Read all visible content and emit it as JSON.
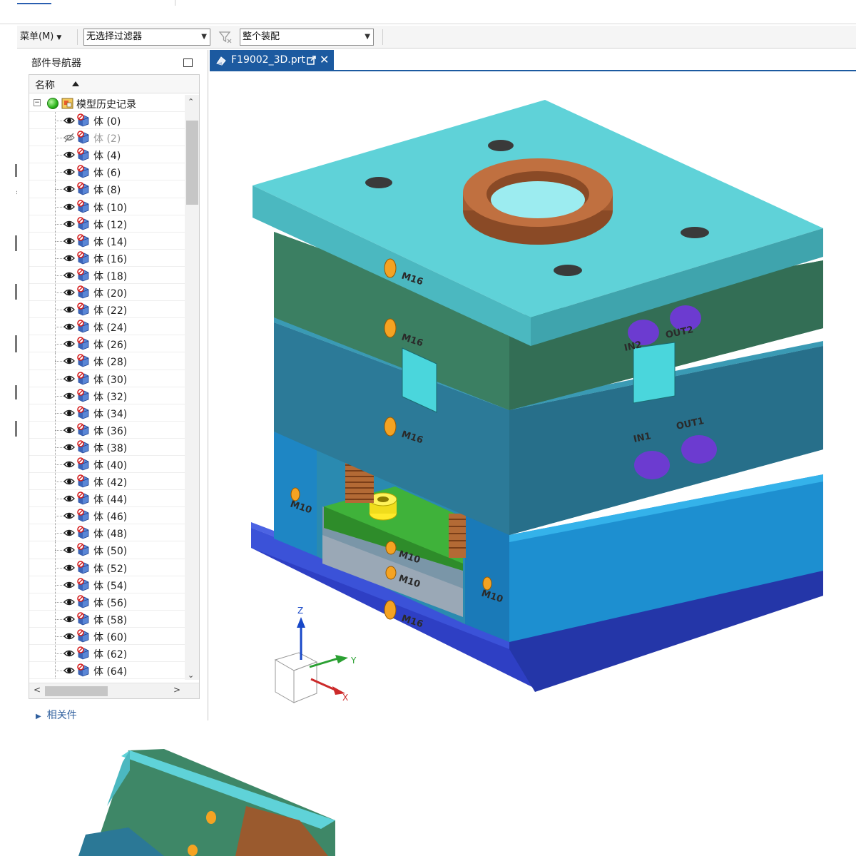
{
  "toolbar": {
    "menu_label": "菜单(M)",
    "filter_select": "无选择过滤器",
    "scope_select": "整个装配"
  },
  "navigator": {
    "title": "部件导航器",
    "column_name": "名称",
    "root_label": "模型历史记录",
    "items": [
      {
        "label": "体 (0)",
        "visible": true
      },
      {
        "label": "体 (2)",
        "visible": false
      },
      {
        "label": "体 (4)",
        "visible": true
      },
      {
        "label": "体 (6)",
        "visible": true
      },
      {
        "label": "体 (8)",
        "visible": true
      },
      {
        "label": "体 (10)",
        "visible": true
      },
      {
        "label": "体 (12)",
        "visible": true
      },
      {
        "label": "体 (14)",
        "visible": true
      },
      {
        "label": "体 (16)",
        "visible": true
      },
      {
        "label": "体 (18)",
        "visible": true
      },
      {
        "label": "体 (20)",
        "visible": true
      },
      {
        "label": "体 (22)",
        "visible": true
      },
      {
        "label": "体 (24)",
        "visible": true
      },
      {
        "label": "体 (26)",
        "visible": true
      },
      {
        "label": "体 (28)",
        "visible": true
      },
      {
        "label": "体 (30)",
        "visible": true
      },
      {
        "label": "体 (32)",
        "visible": true
      },
      {
        "label": "体 (34)",
        "visible": true
      },
      {
        "label": "体 (36)",
        "visible": true
      },
      {
        "label": "体 (38)",
        "visible": true
      },
      {
        "label": "体 (40)",
        "visible": true
      },
      {
        "label": "体 (42)",
        "visible": true
      },
      {
        "label": "体 (44)",
        "visible": true
      },
      {
        "label": "体 (46)",
        "visible": true
      },
      {
        "label": "体 (48)",
        "visible": true
      },
      {
        "label": "体 (50)",
        "visible": true
      },
      {
        "label": "体 (52)",
        "visible": true
      },
      {
        "label": "体 (54)",
        "visible": true
      },
      {
        "label": "体 (56)",
        "visible": true
      },
      {
        "label": "体 (58)",
        "visible": true
      },
      {
        "label": "体 (60)",
        "visible": true
      },
      {
        "label": "体 (62)",
        "visible": true
      },
      {
        "label": "体 (64)",
        "visible": true
      }
    ],
    "related_label": "相关件"
  },
  "tab": {
    "file_name": "F19002_3D.prt"
  },
  "model": {
    "labels": {
      "m16": "M16",
      "m10": "M10",
      "in1": "IN1",
      "in2": "IN2",
      "out1": "OUT1",
      "out2": "OUT2"
    },
    "axes": {
      "x": "X",
      "y": "Y",
      "z": "Z"
    },
    "colors": {
      "top_plate": "#5fd2d8",
      "a_plate": "#3f8a6a",
      "b_plate": "#2f7a8a",
      "support_block": "#1f96d4",
      "bottom_plate": "#3a4fd0",
      "locating_ring": "#b0643a",
      "connectors": "#6c3bd0",
      "ejector_plate": "#3fb23a",
      "springs": "#b36a35"
    }
  }
}
